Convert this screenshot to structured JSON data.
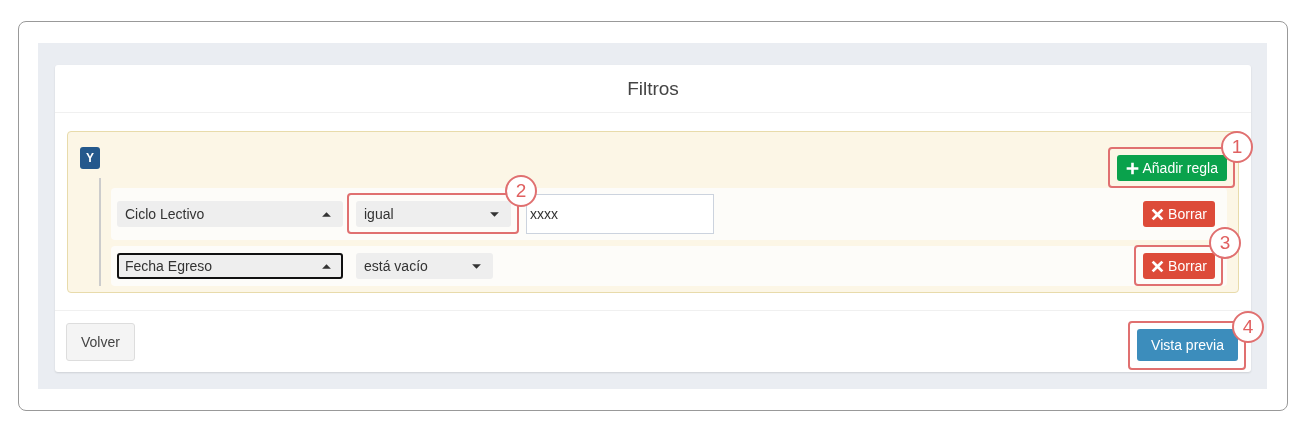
{
  "panel": {
    "title": "Filtros"
  },
  "group": {
    "conjunction": "Y",
    "add_button": {
      "label": "Añadir regla",
      "callout": "1"
    },
    "rules": [
      {
        "field": {
          "value": "Ciclo Lectivo",
          "focused": false
        },
        "operator": {
          "value": "igual",
          "callout": "2"
        },
        "value_input": {
          "value": "xxxx"
        },
        "delete_button": {
          "label": "Borrar"
        }
      },
      {
        "field": {
          "value": "Fecha Egreso",
          "focused": true
        },
        "operator": {
          "value": "está vacío"
        },
        "delete_button": {
          "label": "Borrar",
          "callout": "3"
        }
      }
    ]
  },
  "footer": {
    "back_button": {
      "label": "Volver"
    },
    "preview_button": {
      "label": "Vista previa",
      "callout": "4"
    }
  }
}
